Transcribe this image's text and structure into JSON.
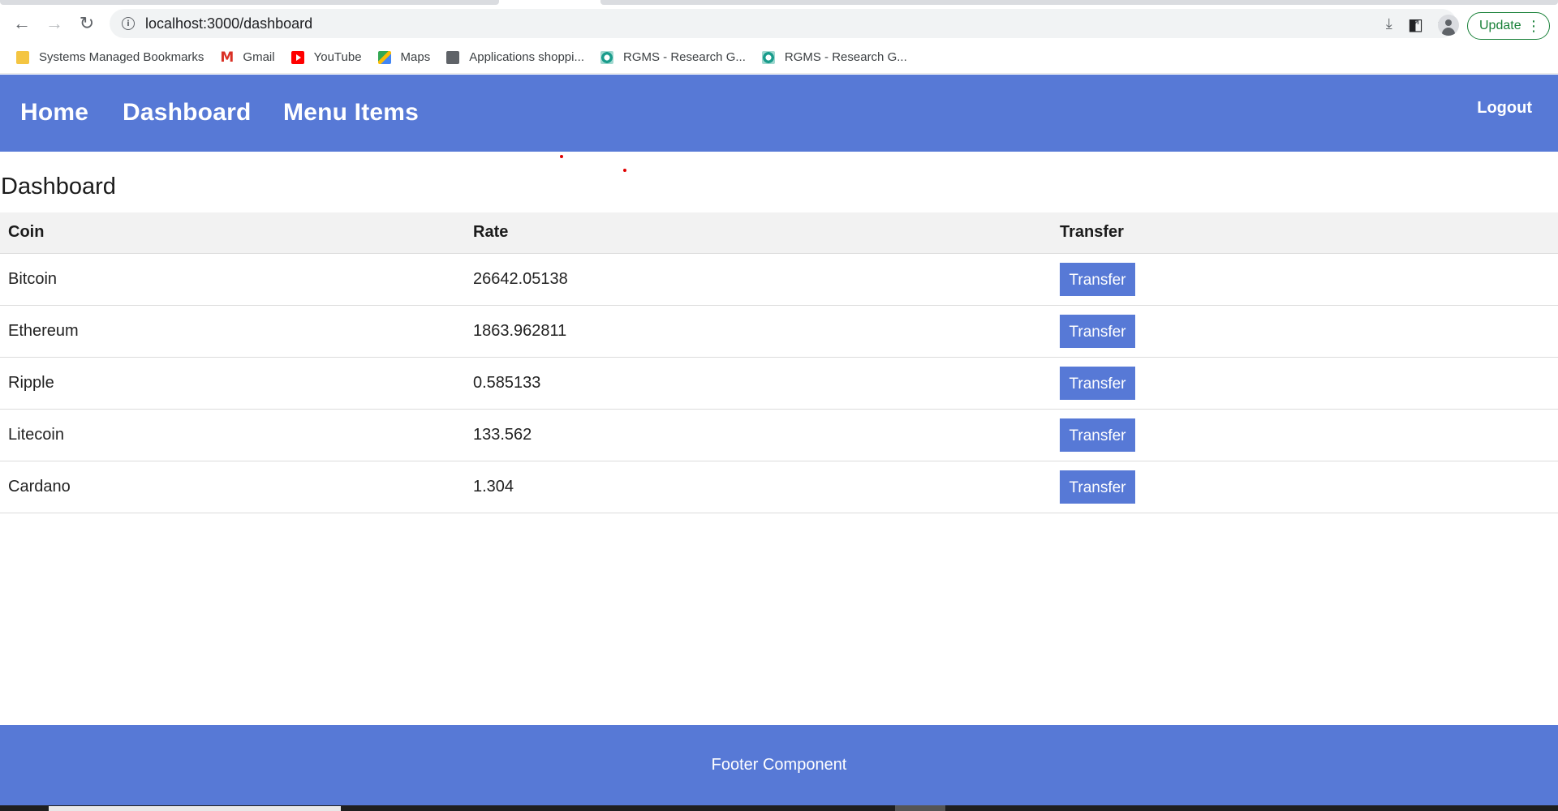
{
  "browser": {
    "url": "localhost:3000/dashboard",
    "update_label": "Update",
    "bookmarks": [
      {
        "label": "Systems Managed Bookmarks",
        "icon": "folder-icon"
      },
      {
        "label": "Gmail",
        "icon": "gmail-icon"
      },
      {
        "label": "YouTube",
        "icon": "youtube-icon"
      },
      {
        "label": "Maps",
        "icon": "maps-icon"
      },
      {
        "label": "Applications shoppi...",
        "icon": "globe-icon"
      },
      {
        "label": "RGMS - Research G...",
        "icon": "rgms-icon"
      },
      {
        "label": "RGMS - Research G...",
        "icon": "rgms-icon"
      }
    ]
  },
  "nav": {
    "links": [
      "Home",
      "Dashboard",
      "Menu Items"
    ],
    "logout": "Logout",
    "color": "#5779d6"
  },
  "page": {
    "title": "Dashboard"
  },
  "table": {
    "headers": [
      "Coin",
      "Rate",
      "Transfer"
    ],
    "rows": [
      {
        "coin": "Bitcoin",
        "rate": "26642.05138",
        "action": "Transfer"
      },
      {
        "coin": "Ethereum",
        "rate": "1863.962811",
        "action": "Transfer"
      },
      {
        "coin": "Ripple",
        "rate": "0.585133",
        "action": "Transfer"
      },
      {
        "coin": "Litecoin",
        "rate": "133.562",
        "action": "Transfer"
      },
      {
        "coin": "Cardano",
        "rate": "1.304",
        "action": "Transfer"
      }
    ]
  },
  "footer": {
    "text": "Footer Component"
  }
}
